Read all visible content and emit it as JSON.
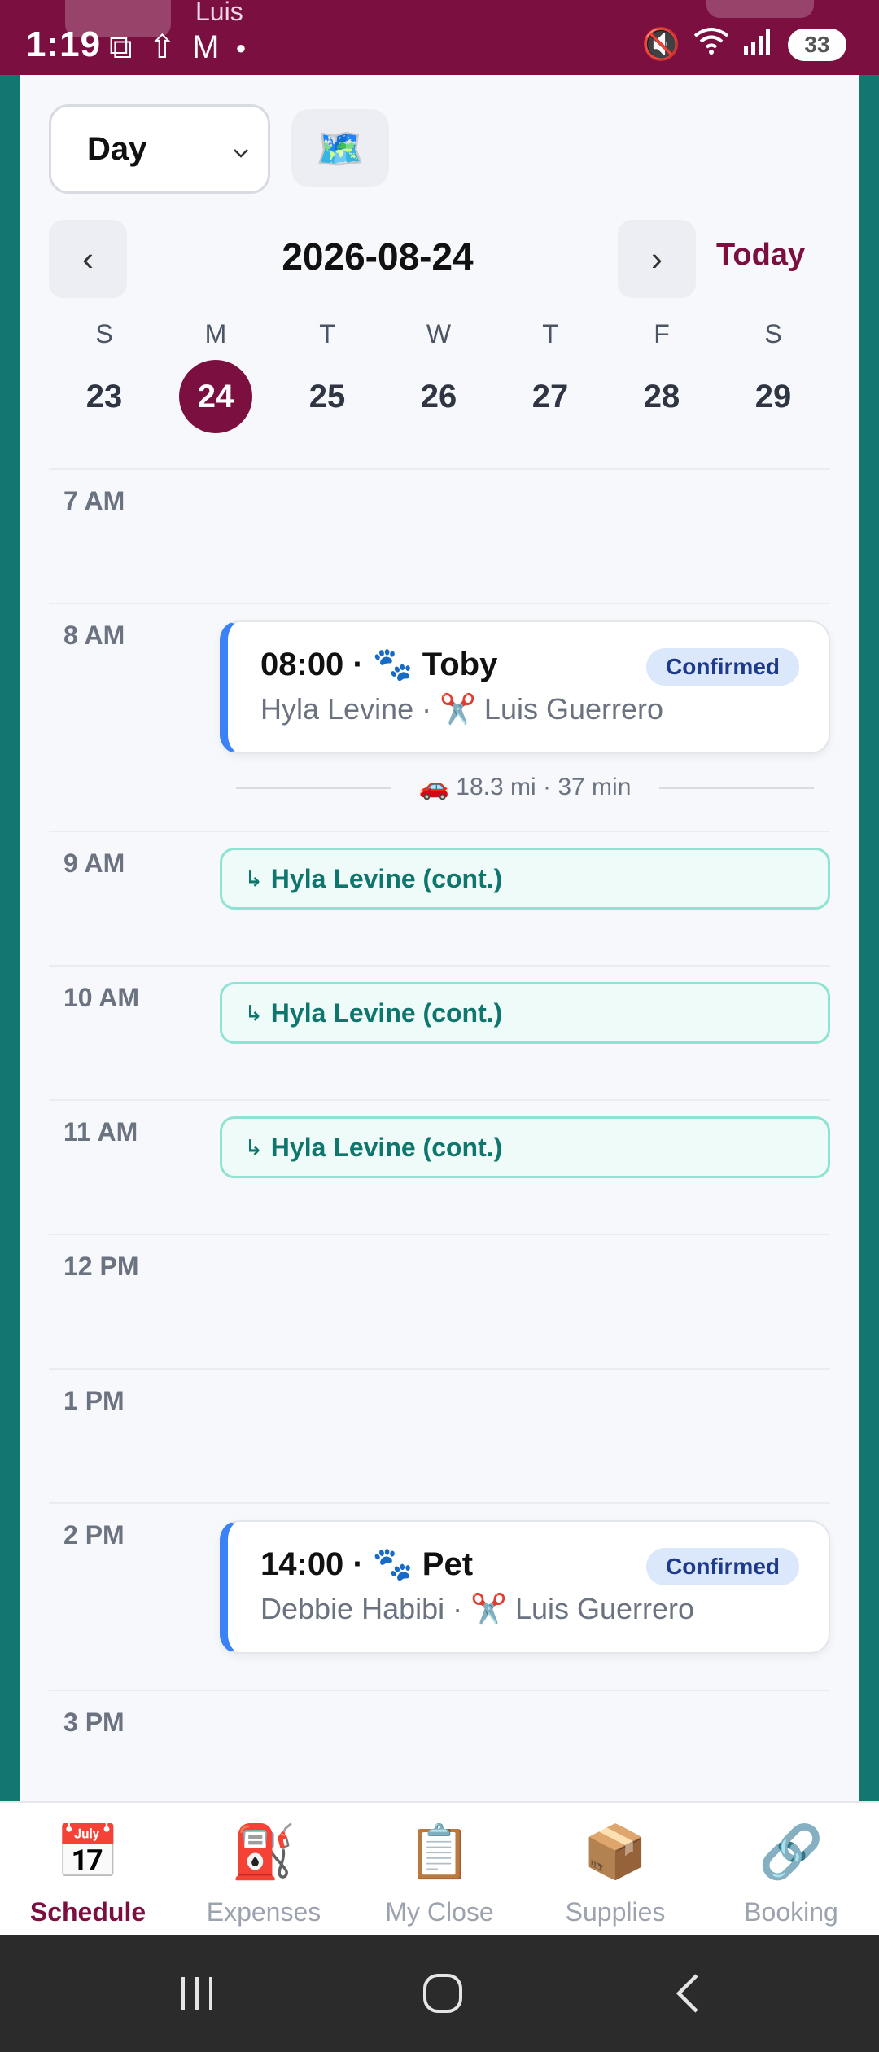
{
  "status_bar": {
    "time": "1:19",
    "battery": "33",
    "peek_name": "Luis"
  },
  "toolbar": {
    "view_mode": "Day",
    "map_icon": "🗺️"
  },
  "date_nav": {
    "prev": "‹",
    "next": "›",
    "date": "2026-08-24",
    "today_label": "Today"
  },
  "week": [
    {
      "letter": "S",
      "num": "23"
    },
    {
      "letter": "M",
      "num": "24"
    },
    {
      "letter": "T",
      "num": "25"
    },
    {
      "letter": "W",
      "num": "26"
    },
    {
      "letter": "T",
      "num": "27"
    },
    {
      "letter": "F",
      "num": "28"
    },
    {
      "letter": "S",
      "num": "29"
    }
  ],
  "hours": [
    "7 AM",
    "8 AM",
    "9 AM",
    "10 AM",
    "11 AM",
    "12 PM",
    "1 PM",
    "2 PM",
    "3 PM"
  ],
  "appointments": [
    {
      "title": "08:00 · 🐾 Toby",
      "subtitle": "Hyla Levine · ✂️ Luis Guerrero",
      "status": "Confirmed"
    },
    {
      "title": "14:00 · 🐾 Pet",
      "subtitle": "Debbie Habibi · ✂️ Luis Guerrero",
      "status": "Confirmed"
    }
  ],
  "travel": "🚗 18.3 mi · 37 min",
  "continuations": [
    {
      "arrow": "↳",
      "label": "Hyla Levine (cont.)"
    },
    {
      "arrow": "↳",
      "label": "Hyla Levine (cont.)"
    },
    {
      "arrow": "↳",
      "label": "Hyla Levine (cont.)"
    }
  ],
  "tabs": [
    {
      "icon": "📅",
      "label": "Schedule"
    },
    {
      "icon": "⛽",
      "label": "Expenses"
    },
    {
      "icon": "📋",
      "label": "My Close"
    },
    {
      "icon": "📦",
      "label": "Supplies"
    },
    {
      "icon": "🔗",
      "label": "Booking"
    }
  ],
  "colors": {
    "brand": "#7a0f40",
    "accent_blue": "#3b82f6",
    "teal": "#0f766e"
  }
}
